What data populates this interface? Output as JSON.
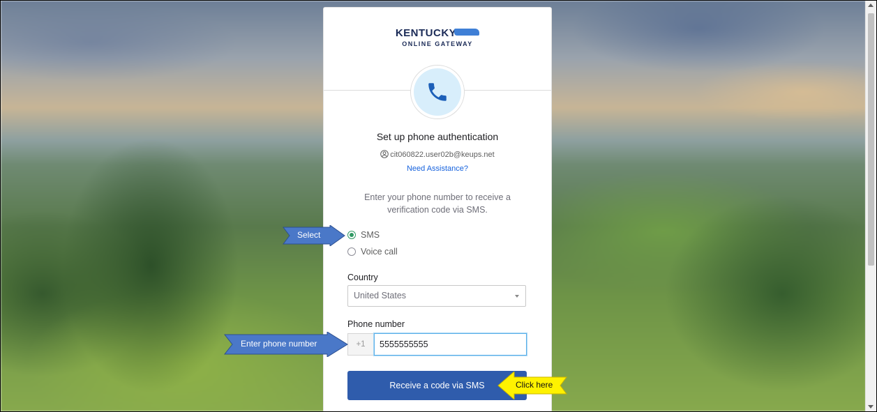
{
  "brand": {
    "name_top": "KENTUCKY",
    "name_bottom": "ONLINE GATEWAY"
  },
  "icon": "phone-icon",
  "title": "Set up phone authentication",
  "user_email": "cit060822.user02b@keups.net",
  "assist_link": "Need Assistance?",
  "instructions": "Enter your phone number to receive a verification code via SMS.",
  "methods": [
    {
      "label": "SMS",
      "selected": true
    },
    {
      "label": "Voice call",
      "selected": false
    }
  ],
  "country": {
    "label": "Country",
    "value": "United States"
  },
  "phone": {
    "label": "Phone number",
    "prefix": "+1",
    "value": "5555555555"
  },
  "submit_label": "Receive a code via SMS",
  "callouts": {
    "select": "Select",
    "enter_phone": "Enter phone number",
    "click_here": "Click here"
  },
  "colors": {
    "primary_button": "#2f5cac",
    "link": "#1662dd",
    "radio_selected": "#2f9a63",
    "callout_blue": "#4a78c8",
    "callout_yellow": "#fff200"
  }
}
